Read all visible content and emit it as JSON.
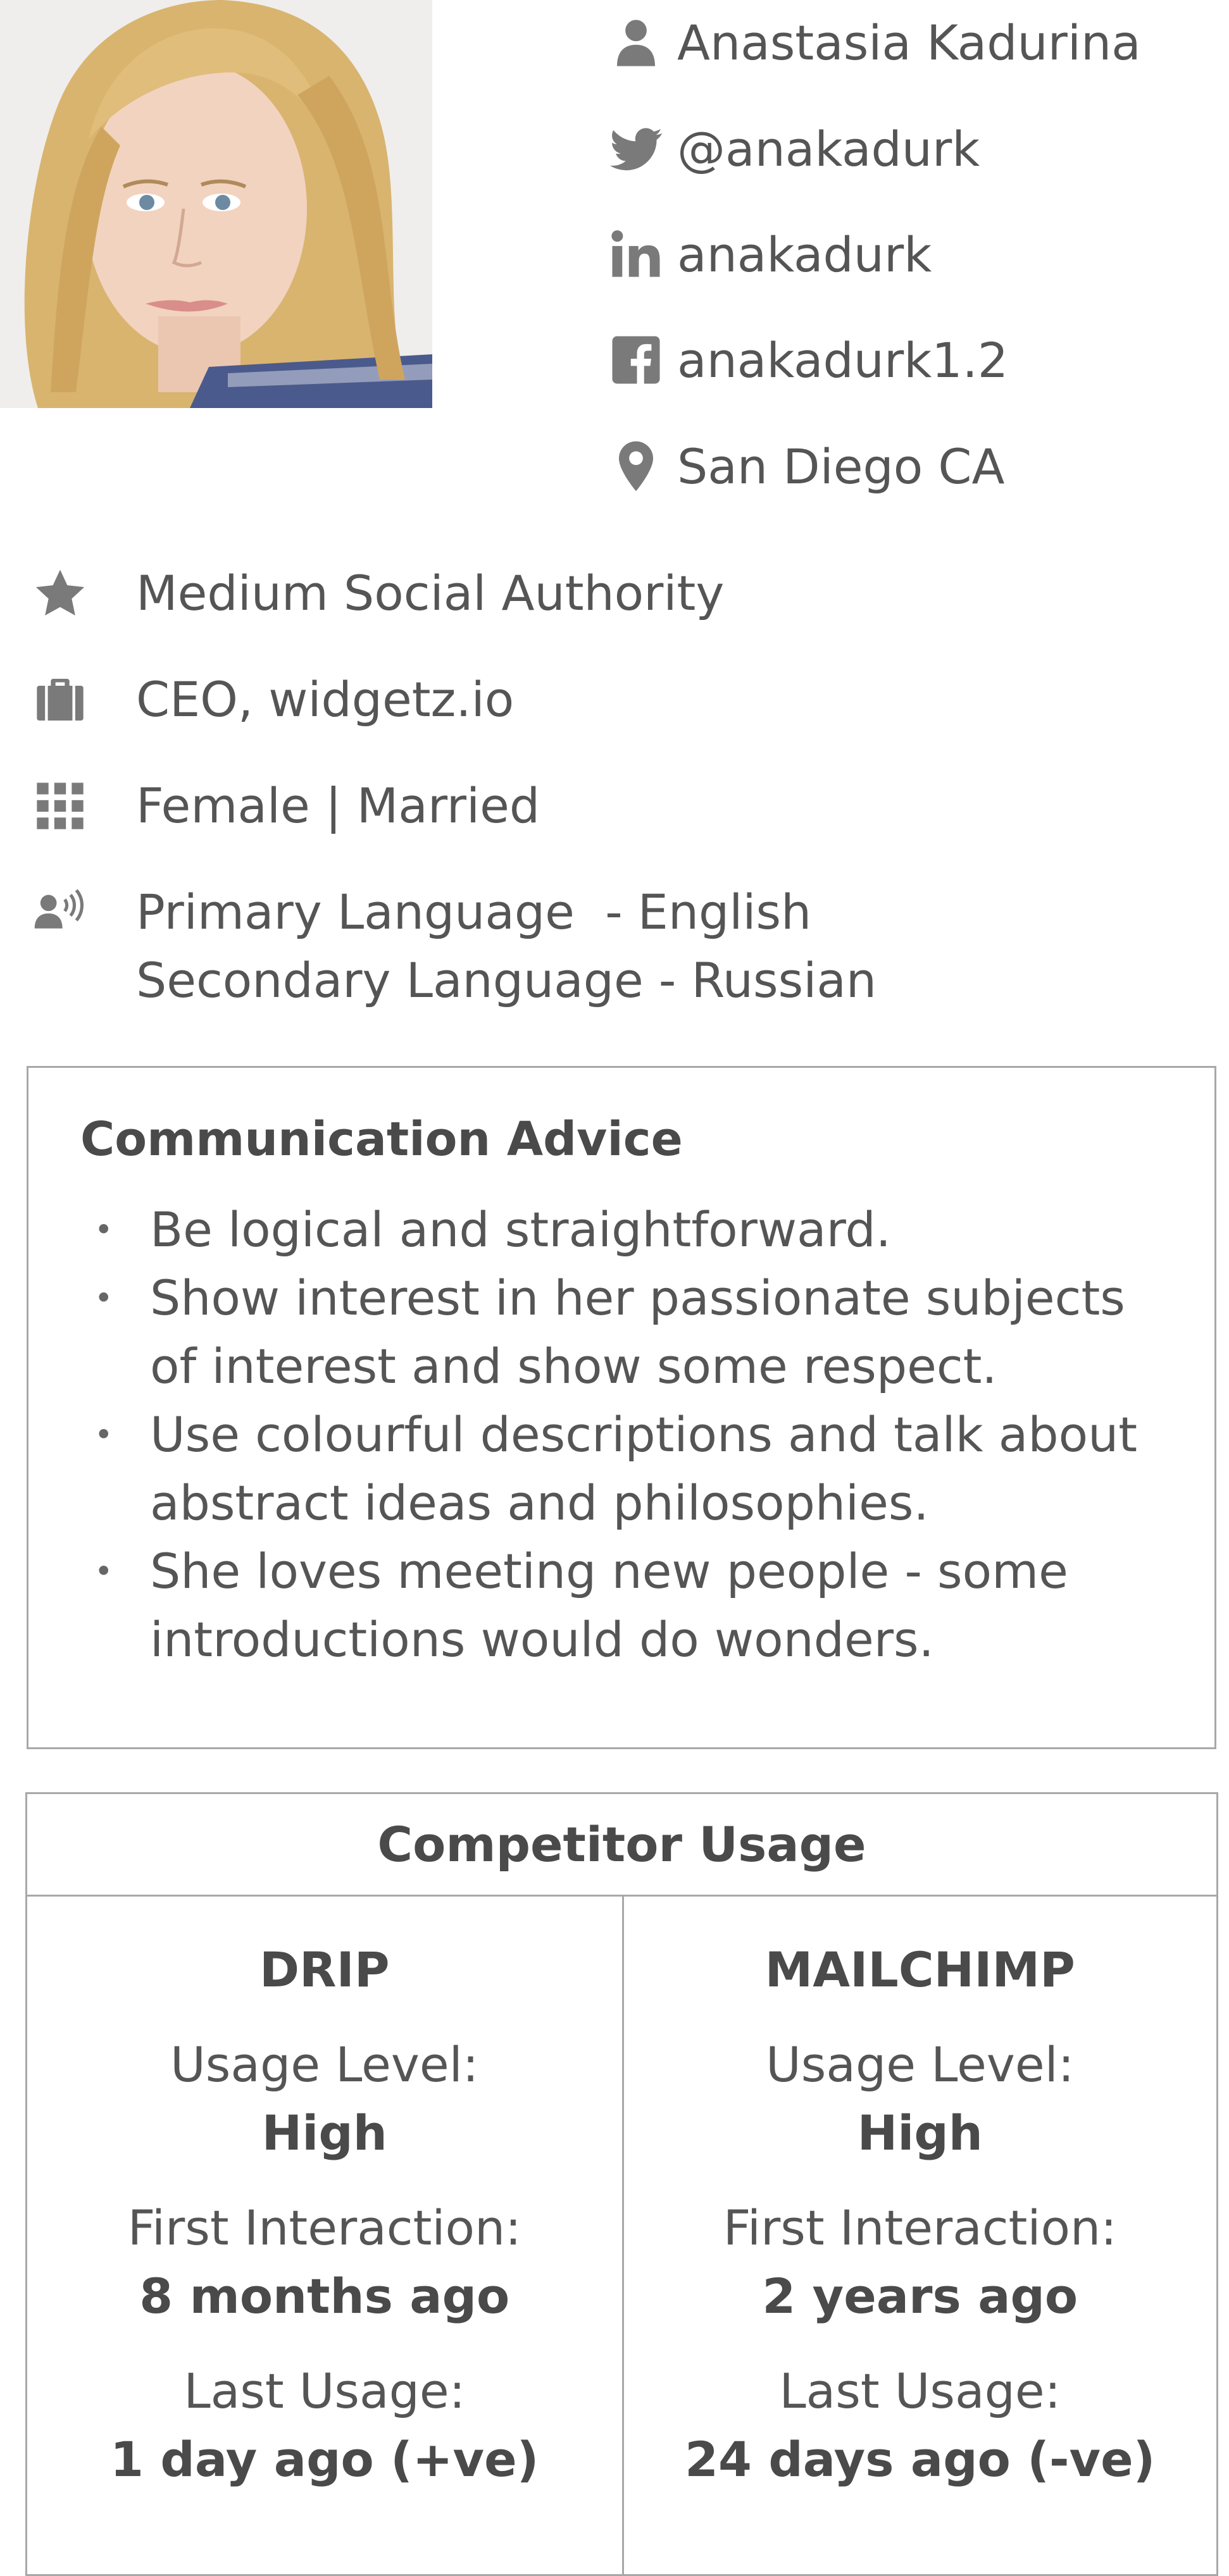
{
  "profile": {
    "name": "Anastasia Kadurina",
    "twitter": "@anakadurk",
    "linkedin": "anakadurk",
    "facebook": "anakadurk1.2",
    "location": "San Diego CA",
    "icons": [
      "person-icon",
      "twitter-icon",
      "linkedin-icon",
      "facebook-icon",
      "location-pin-icon"
    ]
  },
  "details": {
    "authority": "Medium Social Authority",
    "job": "CEO, widgetz.io",
    "demographics": "Female | Married",
    "language_primary": "Primary Language  - English",
    "language_secondary": "Secondary Language - Russian",
    "icons": [
      "star-icon",
      "briefcase-icon",
      "grid-icon",
      "speaking-person-icon"
    ]
  },
  "advice": {
    "title": "Communication Advice",
    "items": [
      [
        "Be logical and straightforward."
      ],
      [
        "Show interest in her passionate subjects",
        "of interest and show some respect."
      ],
      [
        "Use colourful descriptions and talk about",
        "abstract ideas and philosophies."
      ],
      [
        "She loves meeting new people - some",
        "introductions would do wonders."
      ]
    ]
  },
  "competitors": {
    "title": "Competitor Usage",
    "items": [
      {
        "name": "DRIP",
        "usage_label": "Usage Level:",
        "usage_value": "High",
        "first_label": "First Interaction:",
        "first_value": "8 months ago",
        "last_label": "Last Usage:",
        "last_value": "1 day ago (+ve)"
      },
      {
        "name": "MAILCHIMP",
        "usage_label": "Usage Level:",
        "usage_value": "High",
        "first_label": "First Interaction:",
        "first_value": "2 years ago",
        "last_label": "Last Usage:",
        "last_value": "24 days ago (-ve)"
      }
    ]
  }
}
